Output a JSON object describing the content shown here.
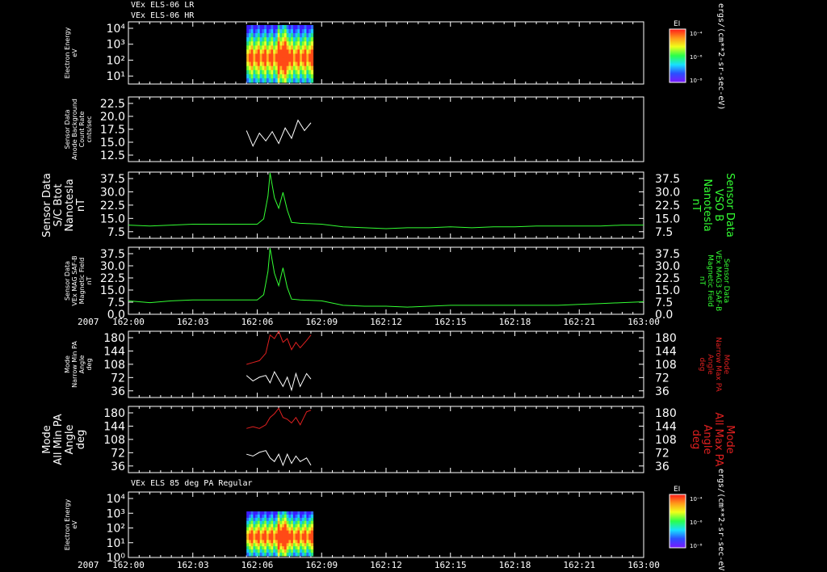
{
  "colors": {
    "background": "#000000",
    "axes": "#ffffff",
    "white_series": "#ffffff",
    "green_series": "#33ff33",
    "red_series": "#e02020"
  },
  "header": {
    "line1": "VEx ELS-06 LR",
    "line2": "VEx ELS-06 HR",
    "panel7_title": "VEx ELS 85 deg PA Regular"
  },
  "time_axis": {
    "year": "2007",
    "ticks": [
      "162:00",
      "162:03",
      "162:06",
      "162:09",
      "162:12",
      "162:15",
      "162:18",
      "162:21",
      "163:00"
    ]
  },
  "colorbar": {
    "title": "EI",
    "ticks": [
      "10⁻⁴",
      "10⁻⁶",
      "10⁻⁸"
    ],
    "unit": "ergs/(cm**2-sr-sec-eV)"
  },
  "panels": [
    {
      "id": "p1",
      "ylabel": [
        "Electron Energy",
        "eV"
      ],
      "yticks_left": [
        "10⁴",
        "10³",
        "10²",
        "10¹"
      ]
    },
    {
      "id": "p2",
      "ylabel": [
        "Sensor Data",
        "Anode Background",
        "Count Rate",
        "cnts/sec"
      ],
      "yticks_left": [
        "22.5",
        "20.0",
        "17.5",
        "15.0",
        "12.5"
      ]
    },
    {
      "id": "p3",
      "ylabel": [
        "Sensor Data",
        "S/C Btot",
        "Nanotesla",
        "nT"
      ],
      "yticks_left": [
        "37.5",
        "30.0",
        "22.5",
        "15.0",
        "7.5"
      ],
      "yticks_right": [
        "37.5",
        "30.0",
        "22.5",
        "15.0",
        "7.5"
      ],
      "rlabel": [
        "Sensor Data",
        "VSO B",
        "Nanotesla",
        "nT"
      ]
    },
    {
      "id": "p4",
      "ylabel": [
        "Sensor Data",
        "VEx MAG SAF-B",
        "Magnetic Field",
        "nT"
      ],
      "yticks_left": [
        "37.5",
        "30.0",
        "22.5",
        "15.0",
        "7.5",
        "0.0"
      ],
      "yticks_right": [
        "37.5",
        "30.0",
        "22.5",
        "15.0",
        "7.5",
        "0.0"
      ],
      "rlabel": [
        "Sensor Data",
        "VEx MAG3 SAF-B",
        "Magnetic Field",
        "nT"
      ]
    },
    {
      "id": "p5",
      "ylabel": [
        "Mode",
        "Narrow Min PA",
        "Angle",
        "deg"
      ],
      "yticks_left": [
        "180",
        "144",
        "108",
        "72",
        "36"
      ],
      "yticks_right": [
        "180",
        "144",
        "108",
        "72",
        "36"
      ],
      "rlabel": [
        "Mode",
        "Narrow Max PA",
        "Angle",
        "deg"
      ]
    },
    {
      "id": "p6",
      "ylabel": [
        "Mode",
        "All Min PA",
        "Angle",
        "deg"
      ],
      "yticks_left": [
        "180",
        "144",
        "108",
        "72",
        "36"
      ],
      "yticks_right": [
        "180",
        "144",
        "108",
        "72",
        "36"
      ],
      "rlabel": [
        "Mode",
        "All Max PA",
        "Angle",
        "deg"
      ]
    },
    {
      "id": "p7",
      "ylabel": [
        "Electron Energy",
        "eV"
      ],
      "yticks_left": [
        "10⁴",
        "10³",
        "10²",
        "10¹",
        "10⁰"
      ]
    }
  ],
  "chart_data": [
    {
      "type": "heatmap",
      "panel": "p1",
      "x_range": [
        "162:05",
        "162:09"
      ],
      "y_scale": "log",
      "ylabel": "Electron Energy eV"
    },
    {
      "type": "line",
      "panel": "p2",
      "ylim": [
        10,
        22.5
      ],
      "series": [
        {
          "color": "white",
          "x": [
            5.5,
            5.8,
            6.1,
            6.4,
            6.7,
            7.0,
            7.3,
            7.6,
            7.9,
            8.2,
            8.5
          ],
          "values": [
            16.0,
            13.0,
            15.5,
            14.0,
            15.8,
            13.5,
            16.5,
            14.5,
            18.0,
            16.0,
            17.5
          ]
        }
      ]
    },
    {
      "type": "line",
      "panel": "p3",
      "ylim": [
        0,
        37.5
      ],
      "series": [
        {
          "color": "green",
          "x": [
            0,
            1,
            2,
            3,
            4,
            5,
            6.0,
            6.3,
            6.5,
            6.6,
            6.8,
            7.0,
            7.2,
            7.4,
            7.6,
            8,
            9,
            10,
            11,
            12,
            13,
            14,
            15,
            16,
            17,
            18,
            19,
            20,
            21,
            22,
            23,
            24
          ],
          "values": [
            7.5,
            7.0,
            7.5,
            8.0,
            8.0,
            8.0,
            8.0,
            11,
            24,
            37,
            23,
            17,
            26,
            16,
            9,
            8.5,
            8.0,
            6.5,
            6.0,
            5.5,
            6.0,
            6.0,
            6.5,
            6.0,
            6.5,
            6.5,
            7.0,
            7.0,
            7.0,
            7.0,
            7.5,
            7.5
          ]
        }
      ]
    },
    {
      "type": "line",
      "panel": "p4",
      "ylim": [
        0,
        37.5
      ],
      "series": [
        {
          "color": "green",
          "x": [
            0,
            1,
            2,
            3,
            4,
            5,
            6.0,
            6.3,
            6.5,
            6.6,
            6.8,
            7.0,
            7.2,
            7.4,
            7.6,
            8,
            9,
            10,
            11,
            12,
            13,
            14,
            15,
            16,
            17,
            18,
            19,
            20,
            21,
            22,
            23,
            24
          ],
          "values": [
            7.5,
            6.5,
            7.5,
            8.0,
            8.0,
            8.0,
            8.0,
            11,
            24,
            37,
            23,
            16,
            26,
            15,
            8.5,
            8.0,
            7.5,
            5.0,
            4.5,
            4.5,
            4.0,
            4.5,
            5.0,
            5.0,
            5.0,
            5.0,
            5.0,
            5.0,
            5.5,
            6.0,
            6.5,
            7.0
          ]
        }
      ]
    },
    {
      "type": "line",
      "panel": "p5",
      "ylim": [
        0,
        180
      ],
      "series": [
        {
          "name": "Max PA",
          "color": "red",
          "x": [
            5.5,
            5.8,
            6.1,
            6.4,
            6.6,
            6.8,
            7.0,
            7.2,
            7.4,
            7.6,
            7.8,
            8.0,
            8.3,
            8.5
          ],
          "values": [
            90,
            95,
            100,
            120,
            170,
            160,
            180,
            150,
            160,
            130,
            150,
            135,
            155,
            170
          ]
        },
        {
          "name": "Min PA",
          "color": "white",
          "x": [
            5.5,
            5.8,
            6.1,
            6.4,
            6.6,
            6.8,
            7.0,
            7.2,
            7.4,
            7.6,
            7.8,
            8.0,
            8.3,
            8.5
          ],
          "values": [
            60,
            45,
            55,
            60,
            40,
            70,
            50,
            30,
            55,
            20,
            65,
            30,
            65,
            50
          ]
        }
      ]
    },
    {
      "type": "line",
      "panel": "p6",
      "ylim": [
        0,
        180
      ],
      "series": [
        {
          "name": "Max PA",
          "color": "red",
          "x": [
            5.5,
            5.8,
            6.1,
            6.4,
            6.6,
            6.8,
            7.0,
            7.2,
            7.4,
            7.6,
            7.8,
            8.0,
            8.3,
            8.5
          ],
          "values": [
            120,
            125,
            120,
            130,
            150,
            160,
            175,
            150,
            145,
            135,
            150,
            130,
            165,
            170
          ]
        },
        {
          "name": "Min PA",
          "color": "white",
          "x": [
            5.5,
            5.8,
            6.1,
            6.4,
            6.6,
            6.8,
            7.0,
            7.2,
            7.4,
            7.6,
            7.8,
            8.0,
            8.3,
            8.5
          ],
          "values": [
            50,
            45,
            55,
            60,
            40,
            30,
            50,
            20,
            50,
            25,
            45,
            30,
            40,
            20
          ]
        }
      ]
    },
    {
      "type": "heatmap",
      "panel": "p7",
      "x_range": [
        "162:05",
        "162:09"
      ],
      "y_scale": "log",
      "ylabel": "Electron Energy eV"
    }
  ]
}
